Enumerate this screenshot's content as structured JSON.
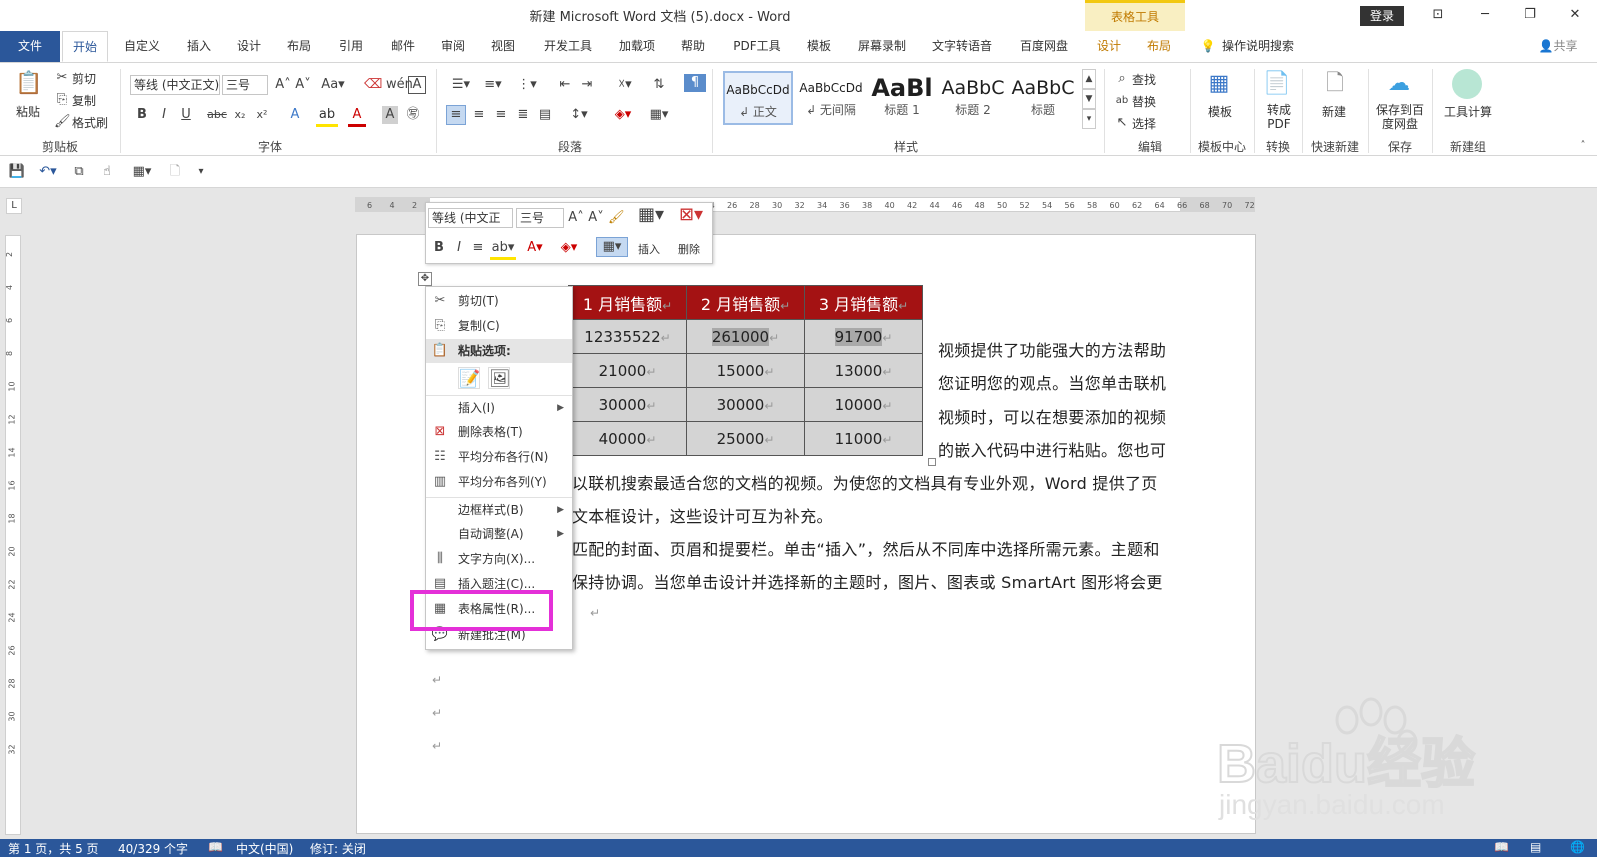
{
  "window": {
    "title": "新建 Microsoft Word 文档 (5).docx - Word",
    "contextual_tab": "表格工具",
    "login_label": "登录",
    "share_label": "共享"
  },
  "ribbon_tabs": [
    "文件",
    "开始",
    "自定义",
    "插入",
    "设计",
    "布局",
    "引用",
    "邮件",
    "审阅",
    "视图",
    "开发工具",
    "加载项",
    "帮助",
    "PDF工具",
    "模板",
    "屏幕录制",
    "文字转语音",
    "百度网盘",
    "设计",
    "布局"
  ],
  "tell_me": "操作说明搜索",
  "clipboard": {
    "paste": "粘贴",
    "cut": "剪切",
    "copy": "复制",
    "format_painter": "格式刷",
    "label": "剪贴板"
  },
  "font": {
    "name": "等线 (中文正文)",
    "size": "三号",
    "label": "字体"
  },
  "paragraph": {
    "label": "段落"
  },
  "styles": {
    "label": "样式",
    "items": [
      {
        "sample": "AaBbCcDd",
        "name": "↲ 正文"
      },
      {
        "sample": "AaBbCcDd",
        "name": "↲ 无间隔"
      },
      {
        "sample": "AaBl",
        "name": "标题 1"
      },
      {
        "sample": "AaBbC",
        "name": "标题 2"
      },
      {
        "sample": "AaBbC",
        "name": "标题"
      }
    ]
  },
  "editing": {
    "find": "查找",
    "replace": "替换",
    "select": "选择",
    "label": "编辑"
  },
  "extra_groups": [
    {
      "btn": "模板",
      "label": "模板中心"
    },
    {
      "btn": "转成PDF",
      "label": "转换"
    },
    {
      "btn": "新建",
      "label": "快速新建"
    },
    {
      "btn": "保存到百度网盘",
      "label": "保存"
    },
    {
      "btn": "工具计算",
      "label": "新建组"
    }
  ],
  "ruler_ticks": [
    "6",
    "4",
    "2",
    "",
    "2",
    "4",
    "6",
    "8",
    "10",
    "12",
    "14",
    "16",
    "18",
    "20",
    "22",
    "24",
    "26",
    "28",
    "30",
    "32",
    "34",
    "36",
    "38",
    "40",
    "42",
    "44",
    "46",
    "48",
    "50",
    "52",
    "54",
    "56",
    "58",
    "60",
    "62",
    "64",
    "66",
    "68",
    "70",
    "72"
  ],
  "vruler_ticks": [
    "2",
    "4",
    "6",
    "8",
    "10",
    "12",
    "14",
    "16",
    "18",
    "20",
    "22",
    "24",
    "26",
    "28",
    "30",
    "32"
  ],
  "mini_toolbar": {
    "font": "等线 (中文正",
    "size": "三号",
    "insert": "插入",
    "delete": "删除"
  },
  "table": {
    "headers": [
      "1 月销售额",
      "2 月销售额",
      "3 月销售额"
    ],
    "rows": [
      [
        "12335522",
        "261000",
        "91700"
      ],
      [
        "21000",
        "15000",
        "13000"
      ],
      [
        "30000",
        "30000",
        "10000"
      ],
      [
        "40000",
        "25000",
        "11000"
      ]
    ]
  },
  "body_text": {
    "side_lines": [
      "视频提供了功能强大的方法帮助",
      "您证明您的观点。当您单击联机",
      "视频时，可以在想要添加的视频",
      "的嵌入代码中进行粘贴。您也可"
    ],
    "full_lines": [
      "以联机搜索最适合您的文档的视频。为使您的文档具有专业外观，Word 提供了页",
      "文本框设计，这些设计可互为补充。",
      "匹配的封面、页眉和提要栏。单击“插入”，然后从不同库中选择所需元素。主题和",
      "保持协调。当您单击设计并选择新的主题时，图片、图表或 SmartArt 图形将会更"
    ]
  },
  "context_menu": [
    {
      "label": "剪切(T)",
      "icon": "scissors-icon",
      "glyph": "✂"
    },
    {
      "label": "复制(C)",
      "icon": "copy-icon",
      "glyph": "⎘"
    },
    {
      "label": "粘贴选项:",
      "icon": "paste-icon",
      "glyph": "📋"
    },
    {
      "label": "插入(I)",
      "icon": "",
      "glyph": "",
      "submenu": true
    },
    {
      "label": "删除表格(T)",
      "icon": "delete-table-icon",
      "glyph": "⊠"
    },
    {
      "label": "平均分布各行(N)",
      "icon": "distribute-rows-icon",
      "glyph": "☷"
    },
    {
      "label": "平均分布各列(Y)",
      "icon": "distribute-columns-icon",
      "glyph": "▥"
    },
    {
      "label": "边框样式(B)",
      "icon": "",
      "glyph": "",
      "submenu": true
    },
    {
      "label": "自动调整(A)",
      "icon": "",
      "glyph": "",
      "submenu": true
    },
    {
      "label": "文字方向(X)...",
      "icon": "text-direction-icon",
      "glyph": "⫼"
    },
    {
      "label": "插入题注(C)...",
      "icon": "caption-icon",
      "glyph": "▤"
    },
    {
      "label": "表格属性(R)...",
      "icon": "table-properties-icon",
      "glyph": "▦"
    },
    {
      "label": "新建批注(M)",
      "icon": "comment-icon",
      "glyph": "💬"
    }
  ],
  "status": {
    "page": "第 1 页，共 5 页",
    "words": "40/329 个字",
    "language": "中文(中国)",
    "track": "修订: 关闭"
  },
  "watermark": {
    "brand": "Baidu经验",
    "url": "jingyan.baidu.com"
  },
  "colors": {
    "accent": "#2b579a",
    "table_header": "#a41213",
    "highlight": "#e430d8"
  }
}
